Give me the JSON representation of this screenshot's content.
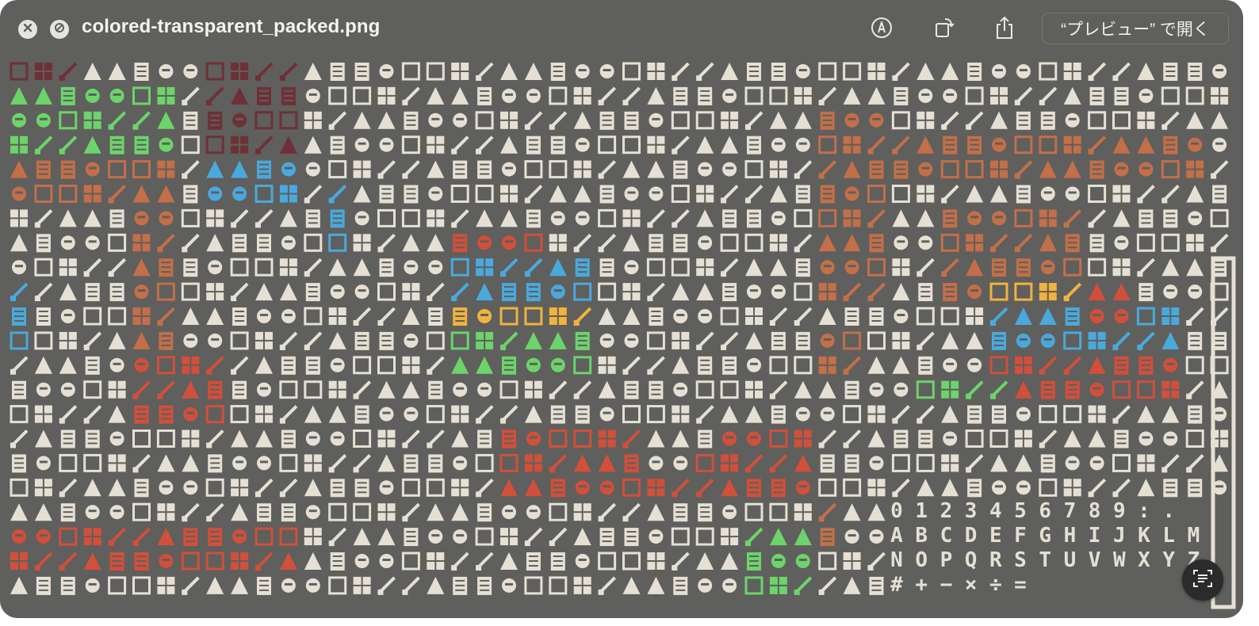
{
  "window": {
    "title": "colored-transparent_packed.png",
    "open_button_label": "“プレビュー” で開く"
  },
  "icons": {
    "close": "xmark-circle-icon",
    "hide": "slash-circle-icon",
    "markup": "pen-circle-icon",
    "rotate": "rotate-icon",
    "share": "share-icon",
    "live_text": "live-text-icon"
  },
  "sheet": {
    "text_rows": [
      {
        "name": "digits-row",
        "glyphs": [
          "0",
          "1",
          "2",
          "3",
          "4",
          "5",
          "6",
          "7",
          "8",
          "9",
          ":",
          "."
        ]
      },
      {
        "name": "letters-row-1",
        "glyphs": [
          "A",
          "B",
          "C",
          "D",
          "E",
          "F",
          "G",
          "H",
          "I",
          "J",
          "K",
          "L",
          "M"
        ]
      },
      {
        "name": "letters-row-2",
        "glyphs": [
          "N",
          "O",
          "P",
          "Q",
          "R",
          "S",
          "T",
          "U",
          "V",
          "W",
          "X",
          "Y",
          "Z"
        ]
      },
      {
        "name": "symbols-row",
        "glyphs": [
          "#",
          "+",
          "−",
          "×",
          "÷",
          "="
        ]
      }
    ],
    "palette": {
      "background": "#5f5f5d",
      "cream": "#e6e0d4",
      "orange": "#c36f49",
      "red": "#d24f3a",
      "maroon": "#6e3036",
      "blue": "#4aa9dc",
      "green": "#6cd46b",
      "yellow": "#f0b33d"
    }
  }
}
